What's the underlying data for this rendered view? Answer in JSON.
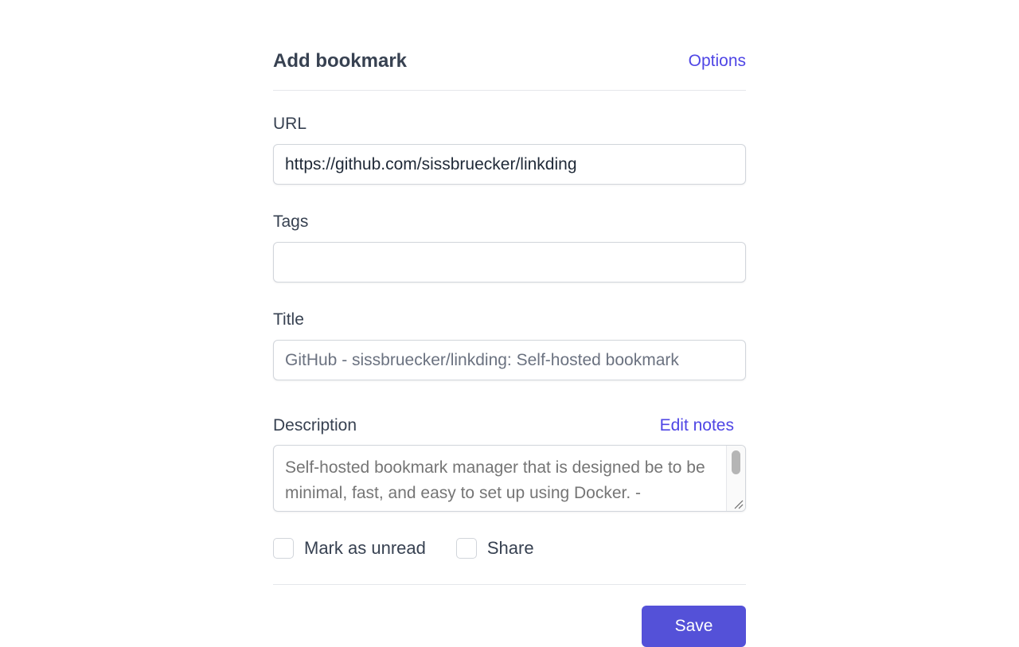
{
  "header": {
    "title": "Add bookmark",
    "options_label": "Options"
  },
  "form": {
    "url": {
      "label": "URL",
      "value": "https://github.com/sissbruecker/linkding"
    },
    "tags": {
      "label": "Tags",
      "value": ""
    },
    "title": {
      "label": "Title",
      "placeholder": "GitHub - sissbruecker/linkding: Self-hosted bookmark"
    },
    "description": {
      "label": "Description",
      "edit_notes_label": "Edit notes",
      "placeholder": "Self-hosted bookmark manager that is designed be to be minimal, fast, and easy to set up using Docker. - sissbruecker/linkding"
    },
    "checkboxes": [
      {
        "label": "Mark as unread",
        "checked": false
      },
      {
        "label": "Share",
        "checked": false
      }
    ]
  },
  "footer": {
    "save_label": "Save"
  },
  "colors": {
    "accent": "#4f46e5",
    "button": "#5451d8",
    "text": "#374151",
    "border": "#d1d5db"
  }
}
